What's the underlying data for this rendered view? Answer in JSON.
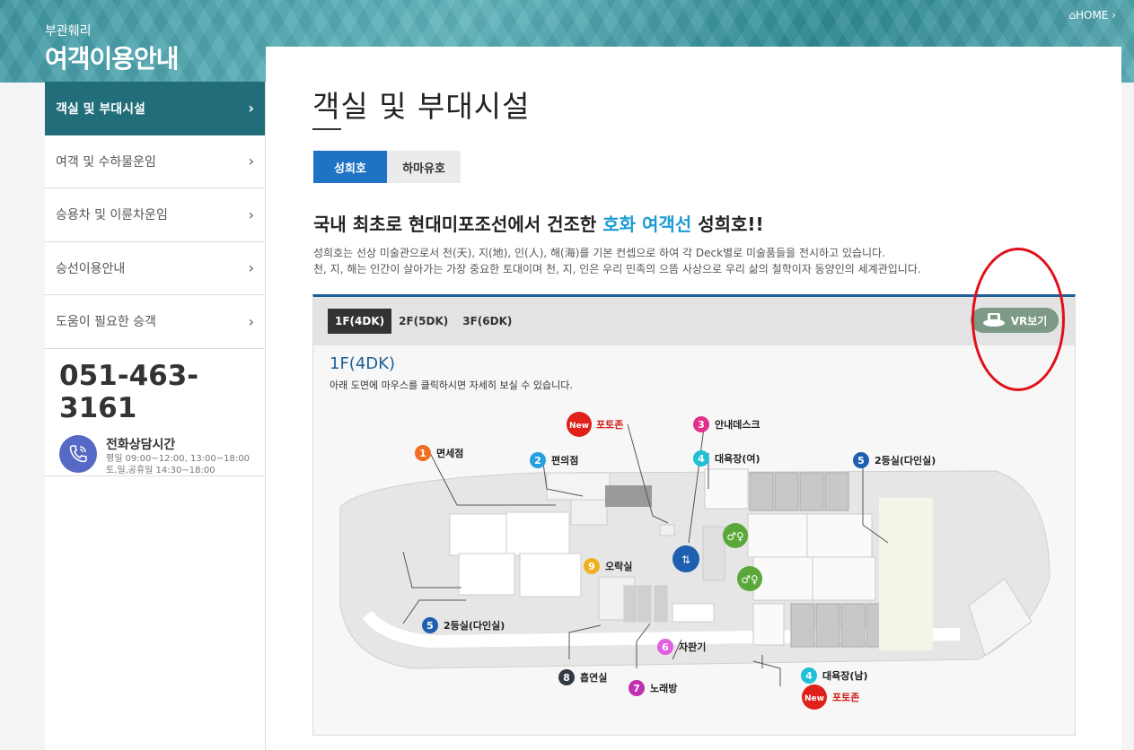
{
  "header": {
    "brand_sub": "부관훼리",
    "brand_title": "여객이용안내",
    "home": "⌂HOME ›"
  },
  "sidebar": {
    "items": [
      {
        "label": "객실 및 부대시설",
        "active": true
      },
      {
        "label": "여객 및 수하물운임",
        "active": false
      },
      {
        "label": "승용차 및 이륜차운임",
        "active": false
      },
      {
        "label": "승선이용안내",
        "active": false
      },
      {
        "label": "도움이 필요한 승객",
        "active": false
      }
    ],
    "chevron": "›",
    "phone": {
      "number": "051-463-3161",
      "title": "전화상담시간",
      "hours1": "평일 09:00~12:00, 13:00~18:00",
      "hours2": "토,일,공휴일 14:30~18:00"
    }
  },
  "main": {
    "title": "객실 및 부대시설",
    "tabs": [
      {
        "label": "성희호",
        "active": true
      },
      {
        "label": "하마유호",
        "active": false
      }
    ],
    "headline_pre": "국내 최초로 현대미포조선에서 건조한 ",
    "headline_hl": "호화 여객선",
    "headline_post": " 성희호!!",
    "desc1": "성희호는 선상 미술관으로서 천(天), 지(地), 인(人), 해(海)를 기본 컨셉으로 하여 각 Deck별로 미술품들을 전시하고 있습니다.",
    "desc2": "천, 지, 해는 인간이 살아가는 가장 중요한 토대이며 천, 지, 인은 우리 민족의 으뜸 사상으로 우리 삶의 철학이자 동양인의 세계관입니다."
  },
  "deck": {
    "tabs": [
      {
        "label": "1F(4DK)",
        "active": true
      },
      {
        "label": "2F(5DK)",
        "active": false
      },
      {
        "label": "3F(6DK)",
        "active": false
      }
    ],
    "vr_label": "VR보기",
    "heading": "1F(4DK)",
    "help": "아래 도면에 마우스를 클릭하시면 자세히 보실 수 있습니다."
  },
  "floorplan": {
    "new_badge": "New",
    "labels": [
      {
        "num": "1",
        "text": "면세점",
        "color": "#f07020"
      },
      {
        "num": "2",
        "text": "편의점",
        "color": "#27a0e0"
      },
      {
        "num": "3",
        "text": "안내데스크",
        "color": "#e0308a"
      },
      {
        "num": "4",
        "text": "대욕장(여)",
        "color": "#20c0d8"
      },
      {
        "num": "5",
        "text": "2등실(다인실)",
        "color": "#1e5fb0"
      },
      {
        "num": "9",
        "text": "오락실",
        "color": "#f0b020"
      },
      {
        "num": "5",
        "text": "2등실(다인실)",
        "color": "#1e5fb0"
      },
      {
        "num": "6",
        "text": "자판기",
        "color": "#e060e0"
      },
      {
        "num": "8",
        "text": "흡연실",
        "color": "#333a44"
      },
      {
        "num": "7",
        "text": "노래방",
        "color": "#c030b0"
      },
      {
        "num": "4",
        "text": "대욕장(남)",
        "color": "#20c0d8"
      }
    ],
    "photozone": "포토존"
  }
}
